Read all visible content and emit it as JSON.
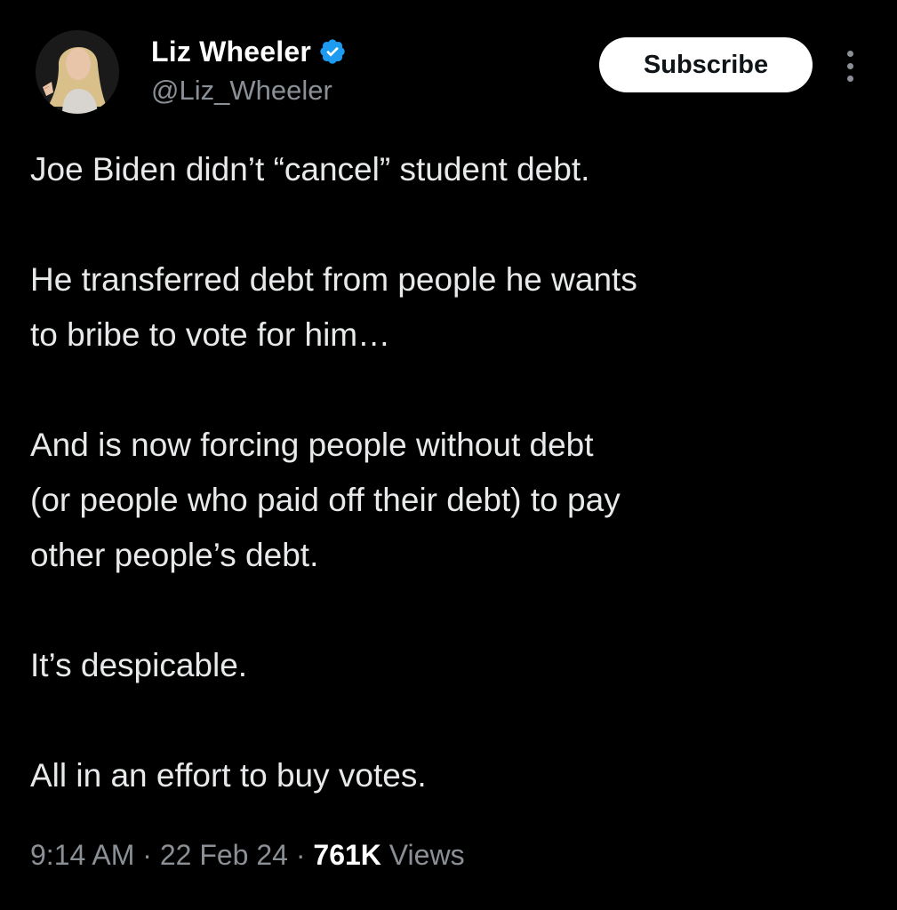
{
  "author": {
    "display_name": "Liz Wheeler",
    "handle": "@Liz_Wheeler",
    "verified": true,
    "verified_color": "#1d9bf0"
  },
  "actions": {
    "subscribe_label": "Subscribe",
    "more_icon": "more-vertical-icon"
  },
  "tweet": {
    "paragraphs": [
      "Joe Biden didn’t “cancel” student debt.",
      "He transferred debt from people he wants\nto bribe to vote for him…",
      "And is now forcing people without debt\n(or people who paid off their debt) to pay\nother people’s debt.",
      "It’s despicable.",
      "All in an effort to buy votes."
    ]
  },
  "meta": {
    "time": "9:14 AM",
    "separator": " · ",
    "date": "22 Feb 24",
    "views_count": "761K",
    "views_label": "Views"
  },
  "colors": {
    "background": "#000000",
    "text": "#e7e9ea",
    "secondary_text": "#8b9096",
    "button_bg": "#ffffff"
  }
}
